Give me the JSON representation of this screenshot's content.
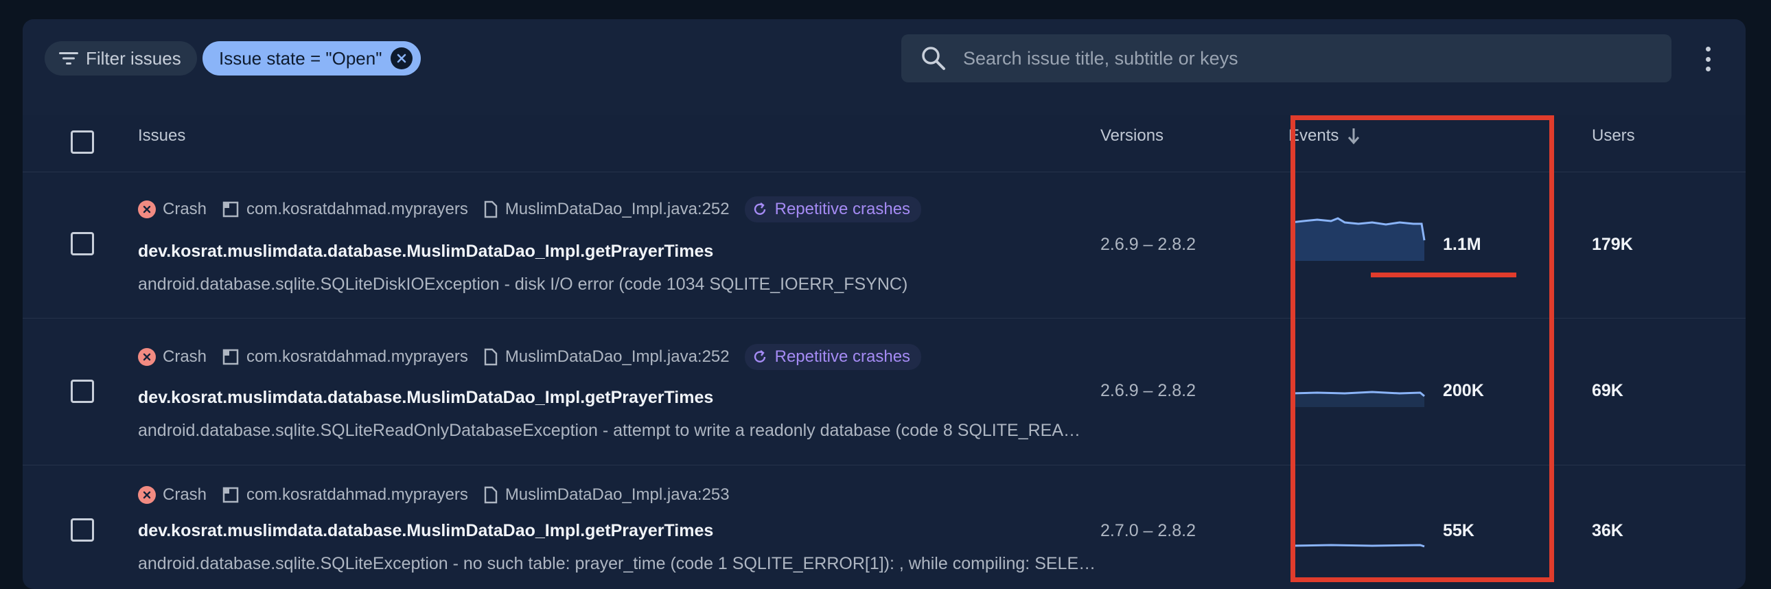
{
  "toolbar": {
    "filter_label": "Filter issues",
    "chip_label": "Issue state = \"Open\"",
    "search_placeholder": "Search issue title, subtitle or keys"
  },
  "columns": {
    "issues": "Issues",
    "versions": "Versions",
    "events": "Events",
    "users": "Users"
  },
  "rows": [
    {
      "type": "Crash",
      "package": "com.kosratdahmad.myprayers",
      "file": "MuslimDataDao_Impl.java:252",
      "badge": "Repetitive crashes",
      "title": "dev.kosrat.muslimdata.database.MuslimDataDao_Impl.getPrayerTimes",
      "subtitle": "android.database.sqlite.SQLiteDiskIOException - disk I/O error (code 1034 SQLITE_IOERR_FSYNC)",
      "versions": "2.6.9 – 2.8.2",
      "events": "1.1M",
      "users": "179K"
    },
    {
      "type": "Crash",
      "package": "com.kosratdahmad.myprayers",
      "file": "MuslimDataDao_Impl.java:252",
      "badge": "Repetitive crashes",
      "title": "dev.kosrat.muslimdata.database.MuslimDataDao_Impl.getPrayerTimes",
      "subtitle": "android.database.sqlite.SQLiteReadOnlyDatabaseException - attempt to write a readonly database (code 8 SQLITE_REA…",
      "versions": "2.6.9 – 2.8.2",
      "events": "200K",
      "users": "69K"
    },
    {
      "type": "Crash",
      "package": "com.kosratdahmad.myprayers",
      "file": "MuslimDataDao_Impl.java:253",
      "title": "dev.kosrat.muslimdata.database.MuslimDataDao_Impl.getPrayerTimes",
      "subtitle": "android.database.sqlite.SQLiteException - no such table: prayer_time (code 1 SQLITE_ERROR[1]): , while compiling: SELE…",
      "versions": "2.7.0 – 2.8.2",
      "events": "55K",
      "users": "36K"
    }
  ],
  "colors": {
    "accent": "#8ab4f8",
    "crash": "#f28b82",
    "badge": "#a58bf4",
    "highlight": "#e03c2c"
  }
}
